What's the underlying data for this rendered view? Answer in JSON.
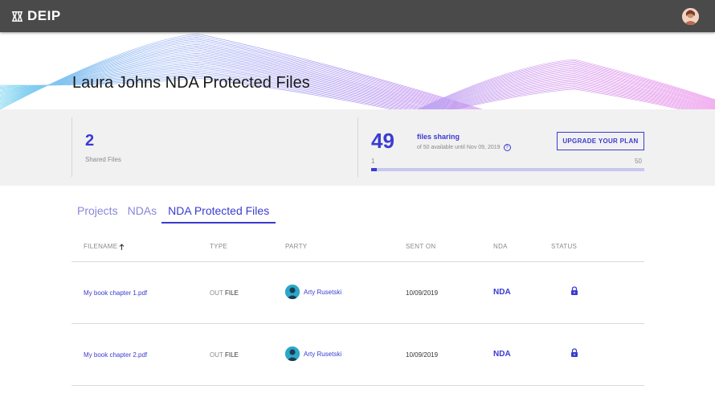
{
  "app": {
    "brand": "DEIP",
    "logo_icon": "deip-logo-icon",
    "user_avatar": "avatar"
  },
  "hero": {
    "title": "Laura Johns NDA Protected Files"
  },
  "stats": {
    "shared": {
      "count": "2",
      "label": "Shared Files"
    },
    "sharing": {
      "count": "49",
      "title": "files sharing",
      "subtitle": "of 50 available until Nov 09, 2019",
      "range_min": "1",
      "range_max": "50",
      "progress_fraction": 0.02
    },
    "upgrade_label": "UPGRADE YOUR PLAN"
  },
  "tabs": [
    {
      "label": "Projects",
      "active": false
    },
    {
      "label": "NDAs",
      "active": false
    },
    {
      "label": "NDA Protected Files",
      "active": true
    }
  ],
  "table": {
    "columns": [
      "FILENAME",
      "TYPE",
      "PARTY",
      "SENT ON",
      "NDA",
      "STATUS"
    ],
    "rows": [
      {
        "filename": "My book chapter 1.pdf",
        "type_prefix": "OUT",
        "type": "FILE",
        "party": "Arty Rusetski",
        "sent_on": "10/09/2019",
        "nda": "NDA",
        "status_icon": "lock-icon"
      },
      {
        "filename": "My book chapter 2.pdf",
        "type_prefix": "OUT",
        "type": "FILE",
        "party": "Arty Rusetski",
        "sent_on": "10/09/2019",
        "nda": "NDA",
        "status_icon": "lock-icon"
      }
    ]
  },
  "colors": {
    "accent": "#3b3bd1",
    "appbar": "#4a4a4a",
    "stats_bg": "#f1f1f1"
  }
}
